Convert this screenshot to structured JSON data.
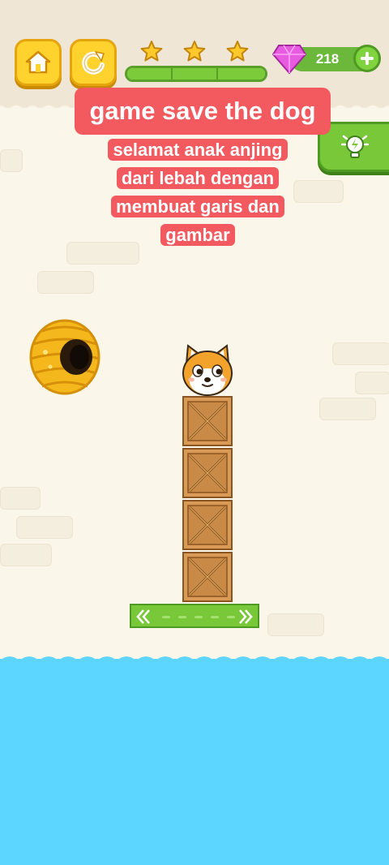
{
  "hud": {
    "home_button": "home-icon",
    "restart_button": "restart-icon",
    "stars_total": 3,
    "level_progress": 1.0,
    "gems": "218",
    "add_gems_button": "plus-icon",
    "hint_button": "lightbulb-icon"
  },
  "caption": {
    "title": "game save the dog",
    "lines": [
      "selamat anak anjing",
      "dari lebah dengan",
      "membuat garis dan",
      "gambar"
    ]
  },
  "scene": {
    "hive": "beehive",
    "character": "shiba-dog",
    "crate_count": 4,
    "platform": "green-moving-platform",
    "hazard": "water"
  },
  "colors": {
    "caption_bg": "#f25a5f",
    "accent_green": "#78c83a",
    "water": "#5cd6ff",
    "star_gold": "#ffc92b"
  }
}
